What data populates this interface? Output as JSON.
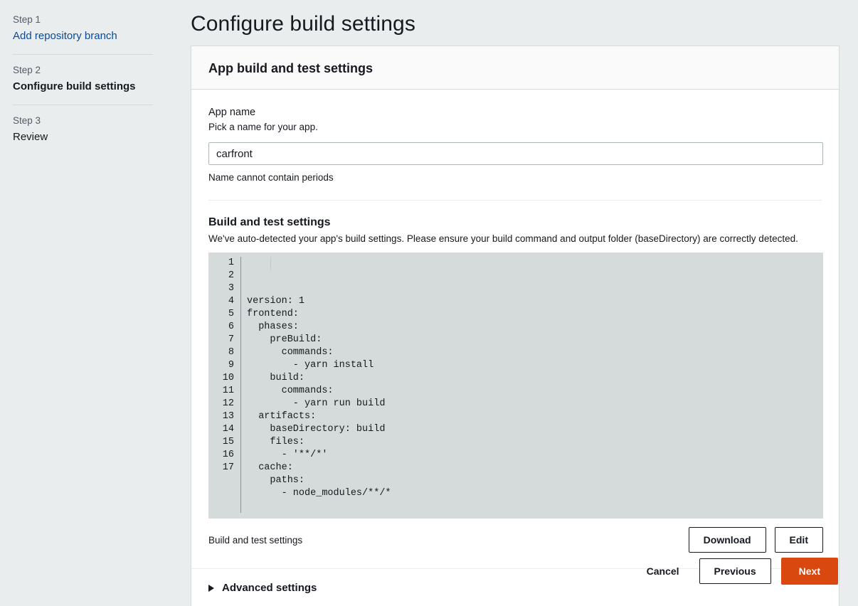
{
  "sidebar": {
    "steps": [
      {
        "step": "Step 1",
        "title": "Add repository branch",
        "state": "link"
      },
      {
        "step": "Step 2",
        "title": "Configure build settings",
        "state": "current"
      },
      {
        "step": "Step 3",
        "title": "Review",
        "state": "default"
      }
    ]
  },
  "header": {
    "page_title": "Configure build settings"
  },
  "card": {
    "title": "App build and test settings",
    "app_name": {
      "label": "App name",
      "description": "Pick a name for your app.",
      "value": "carfront",
      "placeholder": "",
      "hint": "Name cannot contain periods"
    },
    "build_settings": {
      "title": "Build and test settings",
      "description": "We've auto-detected your app's build settings. Please ensure your build command and output folder (baseDirectory) are correctly detected.",
      "code_lines": [
        "version: 1",
        "frontend:",
        "  phases:",
        "    preBuild:",
        "      commands:",
        "        - yarn install",
        "    build:",
        "      commands:",
        "        - yarn run build",
        "  artifacts:",
        "    baseDirectory: build",
        "    files:",
        "      - '**/*'",
        "  cache:",
        "    paths:",
        "      - node_modules/**/*",
        ""
      ],
      "footer_label": "Build and test settings",
      "download_label": "Download",
      "edit_label": "Edit"
    },
    "advanced": {
      "label": "Advanced settings",
      "expanded": false
    }
  },
  "actions": {
    "cancel_label": "Cancel",
    "previous_label": "Previous",
    "next_label": "Next"
  },
  "colors": {
    "primary": "#d9480f",
    "link": "#0a4a98",
    "page_background": "#eaedee",
    "editor_background": "#d5dbdb"
  }
}
